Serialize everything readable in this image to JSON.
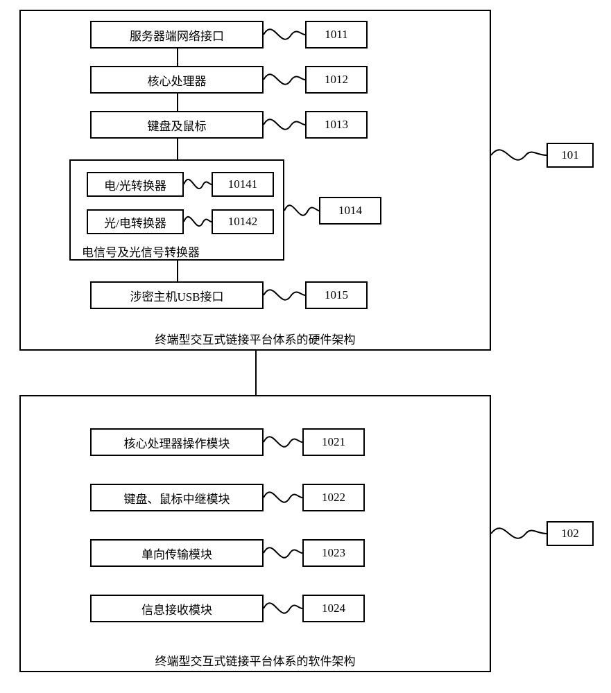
{
  "hardware": {
    "title": "终端型交互式链接平台体系的硬件架构",
    "block_label_id": "101",
    "items": [
      {
        "label": "服务器端网络接口",
        "id": "1011"
      },
      {
        "label": "核心处理器",
        "id": "1012"
      },
      {
        "label": "键盘及鼠标",
        "id": "1013"
      },
      {
        "label": "电信号及光信号转换器",
        "id": "1014",
        "sub": [
          {
            "label": "电/光转换器",
            "id": "10141"
          },
          {
            "label": "光/电转换器",
            "id": "10142"
          }
        ]
      },
      {
        "label": "涉密主机USB接口",
        "id": "1015"
      }
    ]
  },
  "software": {
    "title": "终端型交互式链接平台体系的软件架构",
    "block_label_id": "102",
    "items": [
      {
        "label": "核心处理器操作模块",
        "id": "1021"
      },
      {
        "label": "键盘、鼠标中继模块",
        "id": "1022"
      },
      {
        "label": "单向传输模块",
        "id": "1023"
      },
      {
        "label": "信息接收模块",
        "id": "1024"
      }
    ]
  }
}
